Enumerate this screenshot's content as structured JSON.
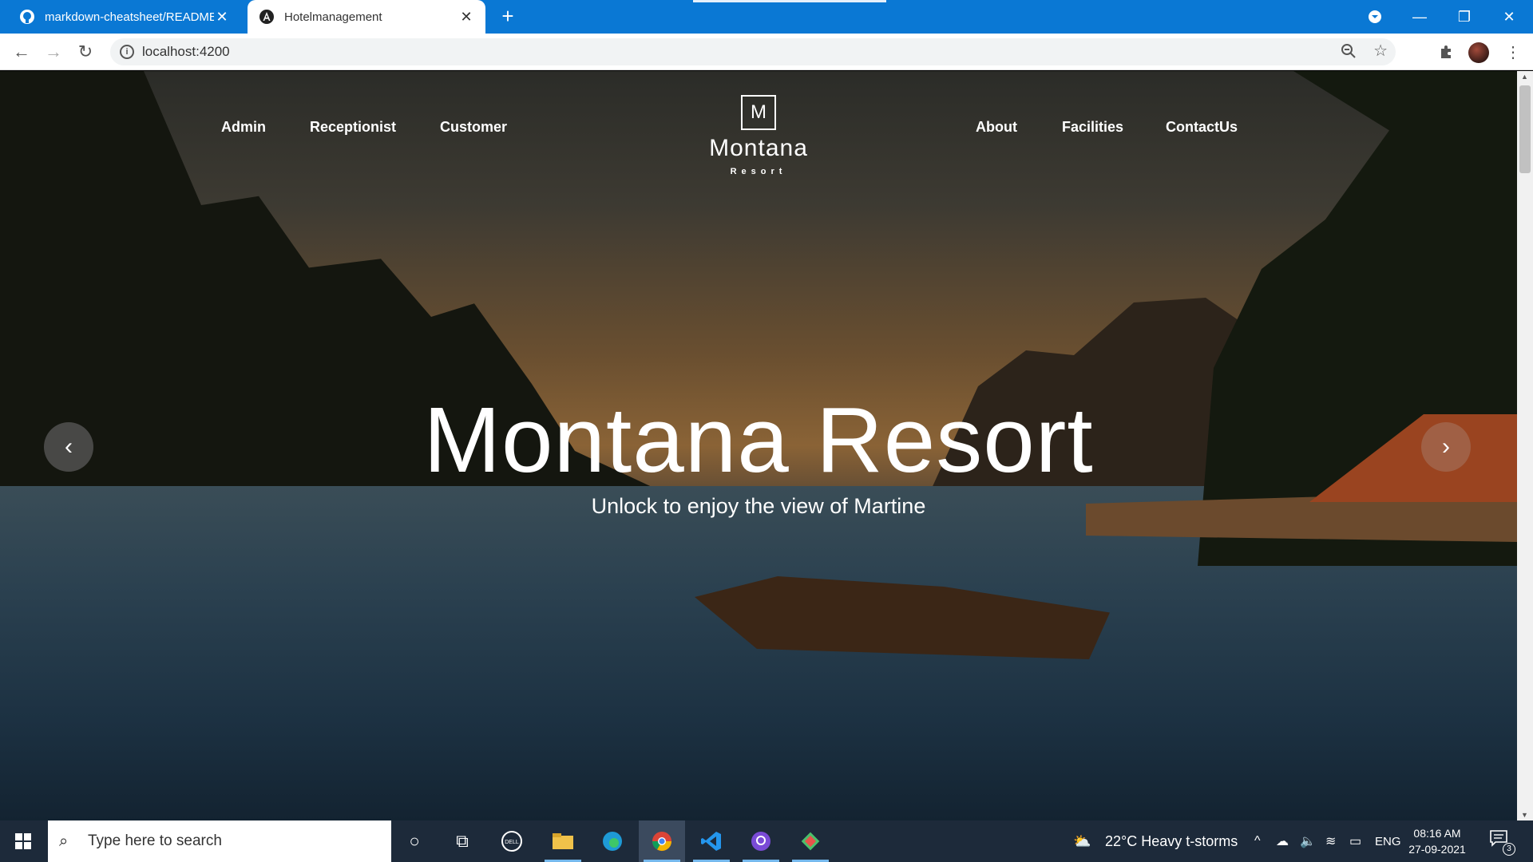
{
  "browser": {
    "tabs": [
      {
        "title": "markdown-cheatsheet/README.",
        "active": false,
        "favicon": "github-icon"
      },
      {
        "title": "Hotelmanagement",
        "active": true,
        "favicon": "angular-icon"
      }
    ],
    "url": "localhost:4200"
  },
  "site": {
    "nav_left": [
      "Admin",
      "Receptionist",
      "Customer"
    ],
    "nav_right": [
      "About",
      "Facilities",
      "ContactUs"
    ],
    "logo_letter": "M",
    "logo_name": "Montana",
    "logo_sub": "Resort"
  },
  "hero": {
    "title": "Montana Resort",
    "subtitle": "Unlock to enjoy the view of Martine"
  },
  "taskbar": {
    "search_placeholder": "Type here to search",
    "weather": "22°C  Heavy t-storms",
    "language": "ENG",
    "time": "08:16 AM",
    "date": "27-09-2021",
    "notifications": "3"
  },
  "colors": {
    "tab_strip": "#0a78d4",
    "taskbar": "#1d2a3a"
  }
}
